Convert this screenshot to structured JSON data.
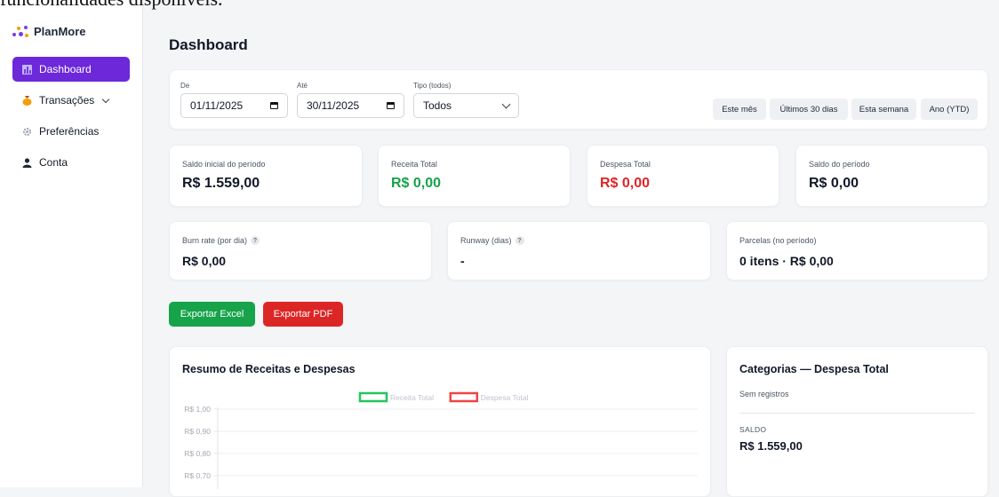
{
  "clipped_text": "funcionalidades disponíveis.",
  "sidebar": {
    "brand": "PlanMore",
    "items": [
      {
        "label": "Dashboard",
        "active": true
      },
      {
        "label": "Transações"
      },
      {
        "label": "Preferências"
      },
      {
        "label": "Conta"
      }
    ]
  },
  "page_title": "Dashboard",
  "filters": {
    "from_label": "De",
    "from_value": "01/11/2025",
    "to_label": "Até",
    "to_value": "30/11/2025",
    "type_label": "Tipo (todos)",
    "type_value": "Todos",
    "quick": [
      "Este mês",
      "Últimos 30 dias",
      "Esta semana",
      "Ano (YTD)"
    ]
  },
  "stats": [
    {
      "label": "Saldo inicial do período",
      "value": "R$ 1.559,00",
      "color": "#111827"
    },
    {
      "label": "Receita Total",
      "value": "R$ 0,00",
      "color": "#16a34a"
    },
    {
      "label": "Despesa Total",
      "value": "R$ 0,00",
      "color": "#dc2626"
    },
    {
      "label": "Saldo do período",
      "value": "R$ 0,00",
      "color": "#111827"
    }
  ],
  "metrics": [
    {
      "label": "Burn rate (por dia)",
      "value": "R$ 0,00"
    },
    {
      "label": "Runway (dias)",
      "value": "-"
    },
    {
      "label": "Parcelas (no período)",
      "value": "0 itens · R$ 0,00"
    }
  ],
  "actions": {
    "excel": "Exportar Excel",
    "pdf": "Exportar PDF"
  },
  "chart_data": {
    "type": "bar",
    "title": "Resumo de Receitas e Despesas",
    "series": [
      {
        "name": "Receita Total",
        "color": "#22c55e",
        "values": []
      },
      {
        "name": "Despesa Total",
        "color": "#ef4444",
        "values": []
      }
    ],
    "yticks": [
      "R$ 1,00",
      "R$ 0,90",
      "R$ 0,80",
      "R$ 0,70"
    ],
    "ylim": [
      0,
      1
    ],
    "legend": "top"
  },
  "categories": {
    "title": "Categorias — Despesa Total",
    "empty": "Sem registros",
    "saldo_label": "SALDO",
    "saldo_value": "R$ 1.559,00"
  },
  "colors": {
    "accent": "#6d28d9",
    "excel": "#16a34a",
    "pdf": "#dc2626"
  }
}
